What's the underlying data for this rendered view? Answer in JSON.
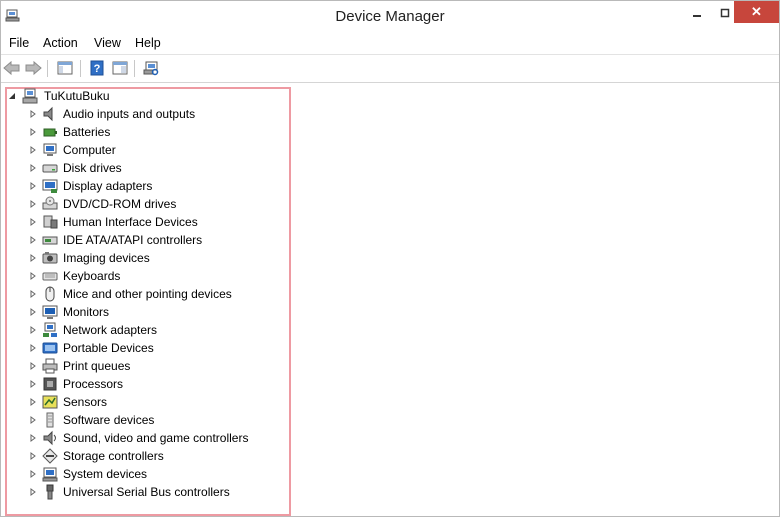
{
  "window": {
    "title": "Device Manager",
    "minimize_label": "—",
    "maximize_label": "□",
    "close_label": "✕"
  },
  "menubar": {
    "items": [
      "File",
      "Action",
      "View",
      "Help"
    ]
  },
  "toolbar": {
    "buttons": [
      "back-arrow-icon",
      "forward-arrow-icon",
      "show-hide-tree-icon",
      "help-icon",
      "properties-icon",
      "scan-hardware-icon"
    ]
  },
  "tree": {
    "root": {
      "label": "TuKutuBuku",
      "expanded": true
    },
    "categories": [
      {
        "label": "Audio inputs and outputs",
        "icon": "speaker-icon"
      },
      {
        "label": "Batteries",
        "icon": "battery-icon"
      },
      {
        "label": "Computer",
        "icon": "computer-icon"
      },
      {
        "label": "Disk drives",
        "icon": "disk-drive-icon"
      },
      {
        "label": "Display adapters",
        "icon": "display-adapter-icon"
      },
      {
        "label": "DVD/CD-ROM drives",
        "icon": "dvd-drive-icon"
      },
      {
        "label": "Human Interface Devices",
        "icon": "hid-icon"
      },
      {
        "label": "IDE ATA/ATAPI controllers",
        "icon": "ide-controller-icon"
      },
      {
        "label": "Imaging devices",
        "icon": "camera-icon"
      },
      {
        "label": "Keyboards",
        "icon": "keyboard-icon"
      },
      {
        "label": "Mice and other pointing devices",
        "icon": "mouse-icon"
      },
      {
        "label": "Monitors",
        "icon": "monitor-icon"
      },
      {
        "label": "Network adapters",
        "icon": "network-adapter-icon"
      },
      {
        "label": "Portable Devices",
        "icon": "portable-device-icon"
      },
      {
        "label": "Print queues",
        "icon": "printer-icon"
      },
      {
        "label": "Processors",
        "icon": "processor-icon"
      },
      {
        "label": "Sensors",
        "icon": "sensor-icon"
      },
      {
        "label": "Software devices",
        "icon": "software-device-icon"
      },
      {
        "label": "Sound, video and game controllers",
        "icon": "sound-controller-icon"
      },
      {
        "label": "Storage controllers",
        "icon": "storage-controller-icon"
      },
      {
        "label": "System devices",
        "icon": "system-device-icon"
      },
      {
        "label": "Universal Serial Bus controllers",
        "icon": "usb-icon"
      }
    ]
  },
  "colors": {
    "highlight_border": "#ee9aa2",
    "close_button": "#c7463c",
    "icon_blue": "#1e5fb4"
  }
}
